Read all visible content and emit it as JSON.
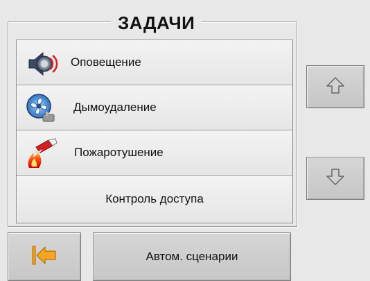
{
  "header": {
    "title": "ЗАДАЧИ"
  },
  "tasks": [
    {
      "label": "Оповещение",
      "icon": "speaker-icon"
    },
    {
      "label": "Дымоудаление",
      "icon": "fan-icon"
    },
    {
      "label": "Пожаротушение",
      "icon": "fire-extinguisher-icon"
    },
    {
      "label": "Контроль доступа",
      "icon": ""
    }
  ],
  "nav": {
    "up_icon": "arrow-up-icon",
    "down_icon": "arrow-down-icon"
  },
  "bottom": {
    "back_icon": "arrow-left-to-bar-icon",
    "scenarios_label": "Автом. сценарии"
  },
  "colors": {
    "accent_back": "#f39c12",
    "panel_bg": "#e8e8e8",
    "button_bg": "#cfcfcf"
  }
}
